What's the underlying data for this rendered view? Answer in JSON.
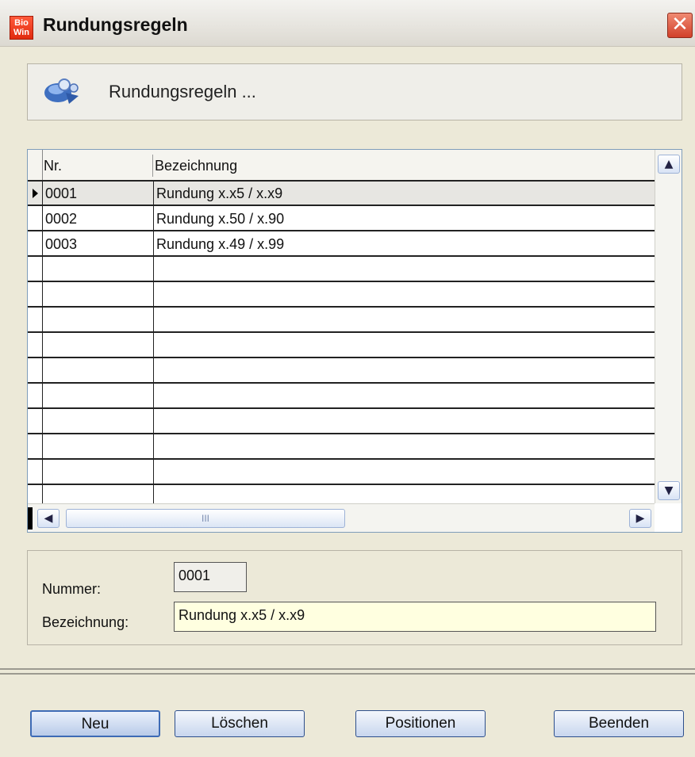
{
  "window": {
    "app_icon_text": "Bio\nWin",
    "title": "Rundungsregeln",
    "close_symbol": "✕"
  },
  "header": {
    "text": "Rundungsregeln ..."
  },
  "grid": {
    "columns": [
      "Nr.",
      "Bezeichnung"
    ],
    "rows": [
      {
        "nr": "0001",
        "bez": "Rundung x.x5 / x.x9",
        "selected": true
      },
      {
        "nr": "0002",
        "bez": "Rundung x.50 / x.90"
      },
      {
        "nr": "0003",
        "bez": "Rundung x.49 / x.99"
      }
    ],
    "empty_rows": 10,
    "scroll_up": "▲",
    "scroll_down": "▼",
    "scroll_left": "◀",
    "scroll_right": "▶",
    "thumb_grip": "III"
  },
  "form": {
    "nummer_label": "Nummer:",
    "nummer_value": "0001",
    "bezeichnung_label": "Bezeichnung:",
    "bezeichnung_value": "Rundung x.x5 / x.x9"
  },
  "buttons": {
    "neu": "Neu",
    "loeschen": "Löschen",
    "positionen": "Positionen",
    "beenden": "Beenden"
  }
}
